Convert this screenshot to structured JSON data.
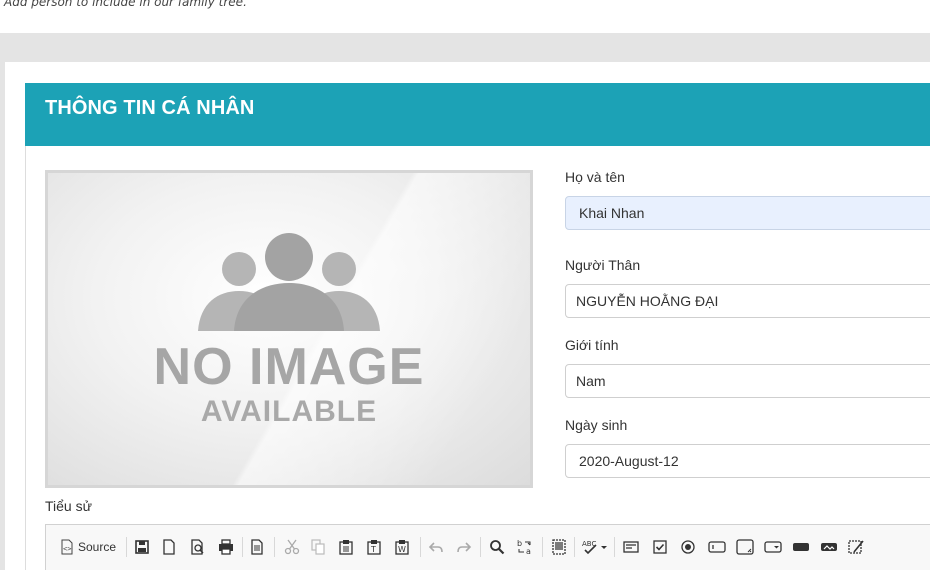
{
  "page": {
    "subtitle": "Add person to include in our family tree."
  },
  "panel": {
    "title": "THÔNG TIN CÁ NHÂN"
  },
  "photo": {
    "placeholder_line1": "NO IMAGE",
    "placeholder_line2": "AVAILABLE"
  },
  "form": {
    "fullname": {
      "label": "Họ và tên",
      "value": "Khai Nhan"
    },
    "relative": {
      "label": "Người Thân",
      "value": "NGUYỄN HOẰNG ĐẠI"
    },
    "gender": {
      "label": "Giới tính",
      "value": "Nam"
    },
    "birthdate": {
      "label": "Ngày sinh",
      "value": "2020-August-12"
    }
  },
  "biography": {
    "label": "Tiểu sử",
    "toolbar": {
      "source_label": "Source",
      "buttons": [
        "source-icon",
        "save-icon",
        "new-page-icon",
        "preview-icon",
        "print-icon",
        "templates-icon",
        "cut-icon",
        "copy-icon",
        "paste-icon",
        "paste-text-icon",
        "paste-word-icon",
        "undo-icon",
        "redo-icon",
        "find-icon",
        "replace-icon",
        "select-all-icon",
        "spellcheck-icon",
        "form-icon",
        "checkbox-icon",
        "radio-icon",
        "text-field-icon",
        "textarea-icon",
        "select-icon",
        "button-icon",
        "image-button-icon",
        "hidden-field-icon"
      ]
    }
  },
  "colors": {
    "header_bg": "#1ca2b6",
    "filled_input_bg": "#e8f0fe"
  }
}
